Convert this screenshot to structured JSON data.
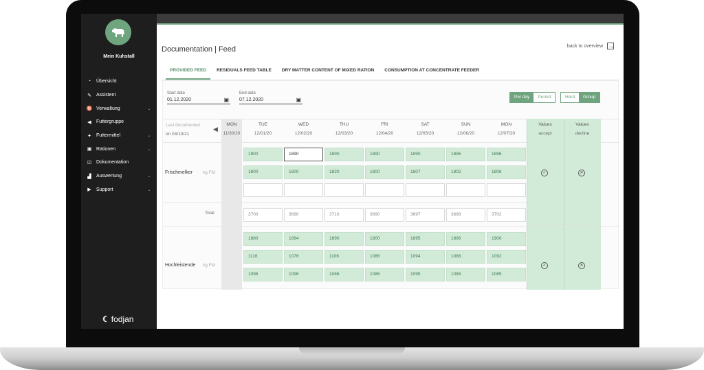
{
  "sidebar": {
    "farm_name": "Mein Kuhstall",
    "items": [
      {
        "icon": "gauge-icon",
        "glyph": "◔",
        "label": "Übersicht",
        "has_chevron": false
      },
      {
        "icon": "wand-icon",
        "glyph": "✎",
        "label": "Assistent",
        "has_chevron": false
      },
      {
        "icon": "cow-icon",
        "glyph": "♉",
        "label": "Verwaltung",
        "has_chevron": true
      },
      {
        "icon": "bullhorn-icon",
        "glyph": "◀",
        "label": "Futtergruppe",
        "has_chevron": false
      },
      {
        "icon": "leaf-icon",
        "glyph": "✦",
        "label": "Futtermittel",
        "has_chevron": true
      },
      {
        "icon": "clipboard-icon",
        "glyph": "▣",
        "label": "Rationen",
        "has_chevron": true
      },
      {
        "icon": "edit-icon",
        "glyph": "☑",
        "label": "Dokumentation",
        "has_chevron": false
      },
      {
        "icon": "bar-chart-icon",
        "glyph": "▟",
        "label": "Auswertung",
        "has_chevron": true
      },
      {
        "icon": "play-icon",
        "glyph": "▶",
        "label": "Support",
        "has_chevron": true
      }
    ],
    "logo": "fodjan"
  },
  "header": {
    "title": "Documentation | Feed",
    "back_label": "back to overview"
  },
  "tabs": [
    {
      "label": "PROVIDED FEED",
      "active": true
    },
    {
      "label": "RESIDUALS FEED TABLE",
      "active": false
    },
    {
      "label": "DRY MATTER CONTENT OF MIXED RATION",
      "active": false
    },
    {
      "label": "CONSUMPTION AT CONCENTRATE FEEDER",
      "active": false
    }
  ],
  "filters": {
    "start_label": "Start date",
    "start_value": "01.12.2020",
    "end_label": "End date",
    "end_value": "07.12.2020",
    "mode_options": [
      "Per day",
      "Period"
    ],
    "mode_selected": "Per day",
    "scope_options": [
      "Herd",
      "Group"
    ],
    "scope_selected": "Group"
  },
  "table": {
    "last_doc_label": "Last documented",
    "last_doc_date": "on 03/10/21",
    "prev_day": {
      "day": "MON",
      "date": "11/30/20"
    },
    "days": [
      {
        "day": "TUE",
        "date": "12/01/20"
      },
      {
        "day": "WED",
        "date": "12/02/20"
      },
      {
        "day": "THU",
        "date": "12/03/20"
      },
      {
        "day": "FRI",
        "date": "12/04/20"
      },
      {
        "day": "SAT",
        "date": "12/05/20"
      },
      {
        "day": "SUN",
        "date": "12/06/20"
      },
      {
        "day": "MON",
        "date": "12/07/20"
      }
    ],
    "accept_header": [
      "Values",
      "accept"
    ],
    "decline_header": [
      "Values",
      "decline"
    ],
    "total_label": "Total",
    "groups": [
      {
        "name": "Frischmelker",
        "unit": "kg FM",
        "rows": [
          [
            "1900",
            "1890",
            "1890",
            "1890",
            "1890",
            "1896",
            "1896"
          ],
          [
            "1800",
            "1800",
            "1820",
            "1800",
            "1807",
            "1802",
            "1806"
          ],
          [
            "",
            "",
            "",
            "",
            "",
            "",
            ""
          ]
        ],
        "totals": [
          "3700",
          "3690",
          "3710",
          "3690",
          "3697",
          "3698",
          "3702"
        ]
      },
      {
        "name": "Hochleistende",
        "unit": "kg FM",
        "rows": [
          [
            "1880",
            "1894",
            "1890",
            "1900",
            "1895",
            "1896",
            "1900"
          ],
          [
            "1116",
            "1076",
            "1106",
            "1086",
            "1094",
            "1088",
            "1092"
          ],
          [
            "1096",
            "1096",
            "1086",
            "1086",
            "1095",
            "1088",
            "1085"
          ]
        ]
      }
    ]
  },
  "colors": {
    "accent": "#6fa57e",
    "cell_green": "#d2ebd8",
    "sidebar_bg": "#1e1e1e"
  }
}
